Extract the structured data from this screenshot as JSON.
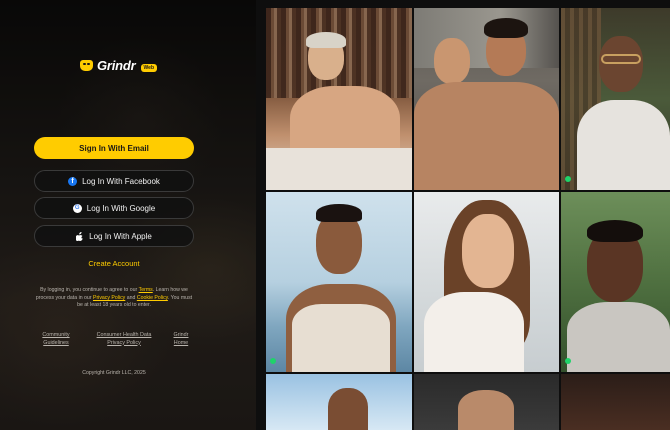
{
  "brand": {
    "name": "Grindr",
    "badge": "Web"
  },
  "auth": {
    "email_button": "Sign In With Email",
    "facebook_button": "Log In With Facebook",
    "google_button": "Log In With Google",
    "apple_button": "Log In With Apple",
    "create_account": "Create Account"
  },
  "legal": {
    "text1": "By logging in, you continue to agree to our ",
    "terms": "Terms",
    "text2": ". Learn how we process your data in our ",
    "privacy": "Privacy Policy",
    "text3": " and ",
    "cookie": "Cookie Policy",
    "text4": ". You must be at least 18 years old to enter."
  },
  "footer": {
    "community_guidelines": [
      "Community",
      "Guidelines"
    ],
    "consumer_health": [
      "Consumer Health Data",
      "Privacy Policy"
    ],
    "grindr_home": [
      "Grindr",
      "Home"
    ],
    "copyright": "Copyright Grindr LLC, 2025"
  },
  "colors": {
    "accent": "#ffcc00",
    "online": "#1fd36a",
    "facebook": "#1877f2"
  },
  "icons": {
    "facebook": "facebook-icon",
    "google": "google-icon",
    "apple": "apple-icon",
    "logo": "grindr-mask-icon"
  },
  "grid": {
    "profiles": [
      {
        "online": false
      },
      {
        "online": false
      },
      {
        "online": true
      },
      {
        "online": true
      },
      {
        "online": false
      },
      {
        "online": true
      },
      {
        "online": false
      },
      {
        "online": false
      },
      {
        "online": false
      }
    ]
  }
}
